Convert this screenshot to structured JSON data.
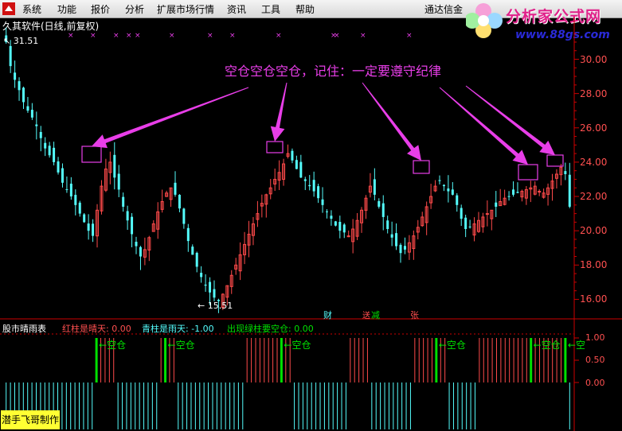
{
  "menu": [
    "系统",
    "功能",
    "报价",
    "分析",
    "扩展市场行情",
    "资讯",
    "工具",
    "帮助"
  ],
  "topright_text": "通达信金",
  "watermark": {
    "title": "分析家公式网",
    "url": "www.88gs.com"
  },
  "chart_title": "久其软件(日线,前复权)",
  "annotation": "空仓空仓空仓，记住：一定要遵守纪律",
  "high_label": "31.51",
  "low_label": "15.51",
  "price_axis_labels": [
    "30.00",
    "28.00",
    "26.00",
    "24.00",
    "22.00",
    "20.00",
    "18.00",
    "16.00"
  ],
  "event_markers": [
    "财",
    "送",
    "减",
    "张"
  ],
  "indicator": {
    "name": "股市晴雨表",
    "red_label": "红柱是晴天: 0.00",
    "cyan_label": "青柱是雨天: -1.00",
    "green_label": "出现绿柱要空仓: 0.00",
    "axis_labels": [
      "1.00",
      "0.50",
      "0.00"
    ],
    "signal_label": "空仓",
    "last_signal_label": "空"
  },
  "footer": "潜手飞哥制作",
  "colors": {
    "up": "#ff4a4a",
    "down": "#54fcfc",
    "green": "#00e000",
    "magenta": "#e83ee8",
    "axis": "#cc0000",
    "red_text": "#ff5050",
    "green_text": "#00e000",
    "cyan_text": "#54fcfc"
  },
  "chart_data": {
    "type": "candlestick",
    "title": "久其软件(日线,前复权)",
    "ylim": [
      15.0,
      31.6
    ],
    "y_ticks": [
      16,
      18,
      20,
      22,
      24,
      26,
      28,
      30
    ],
    "highest": 31.51,
    "lowest": 15.51,
    "close_approx": [
      31.0,
      29.6,
      28.8,
      28.2,
      27.5,
      27.0,
      26.6,
      26.1,
      25.4,
      24.8,
      24.4,
      24.0,
      23.4,
      22.8,
      22.4,
      22.0,
      21.5,
      21.0,
      20.5,
      20.0,
      19.7,
      21.2,
      22.6,
      23.6,
      24.0,
      23.1,
      22.4,
      21.4,
      20.6,
      19.8,
      19.1,
      18.5,
      18.9,
      19.6,
      20.4,
      21.1,
      21.7,
      22.2,
      22.5,
      22.1,
      21.3,
      20.4,
      19.4,
      18.6,
      17.9,
      17.3,
      16.8,
      16.4,
      16.1,
      15.9,
      16.3,
      16.8,
      17.4,
      18.0,
      18.6,
      19.2,
      19.8,
      20.4,
      21.0,
      21.6,
      22.1,
      22.5,
      23.0,
      23.4,
      23.9,
      24.5,
      24.1,
      23.6,
      23.1,
      22.9,
      22.6,
      22.3,
      21.9,
      21.5,
      21.1,
      20.7,
      20.3,
      20.0,
      19.9,
      19.7,
      20.1,
      20.6,
      21.2,
      21.9,
      22.6,
      22.1,
      21.4,
      20.8,
      20.1,
      19.6,
      19.1,
      18.7,
      18.9,
      19.3,
      19.7,
      20.2,
      20.8,
      21.4,
      22.0,
      22.6,
      22.9,
      22.6,
      22.3,
      22.1,
      21.5,
      20.7,
      20.1,
      20.2,
      20.4,
      20.6,
      20.8,
      21.0,
      21.2,
      21.4,
      21.7,
      21.9,
      22.0,
      22.1,
      22.2,
      22.3,
      22.4,
      22.5,
      22.6,
      22.3,
      22.2,
      22.5,
      22.9,
      23.3,
      23.7,
      23.3,
      21.4
    ],
    "indicator_series": {
      "name": "股市晴雨表",
      "ylim": [
        -1.0,
        1.0
      ],
      "y_ticks": [
        0.0,
        0.5,
        1.0
      ],
      "values": [
        -1,
        -1,
        -1,
        -1,
        -1,
        -1,
        -1,
        -1,
        -1,
        -1,
        -1,
        -1,
        -1,
        -1,
        -1,
        -1,
        -1,
        -1,
        -1,
        -1,
        -1,
        0,
        1,
        1,
        1,
        1,
        -1,
        -1,
        -1,
        -1,
        -1,
        -1,
        -1,
        -1,
        -1,
        -1,
        1,
        0,
        1,
        1,
        -1,
        -1,
        -1,
        -1,
        -1,
        -1,
        -1,
        -1,
        -1,
        -1,
        -1,
        -1,
        -1,
        -1,
        -1,
        -1,
        1,
        1,
        1,
        1,
        1,
        1,
        1,
        1,
        0,
        1,
        1,
        -1,
        -1,
        -1,
        -1,
        -1,
        -1,
        -1,
        -1,
        -1,
        -1,
        -1,
        -1,
        -1,
        1,
        1,
        1,
        1,
        1,
        -1,
        -1,
        -1,
        -1,
        -1,
        -1,
        -1,
        -1,
        -1,
        -1,
        1,
        1,
        1,
        1,
        1,
        0,
        1,
        1,
        -1,
        -1,
        -1,
        -1,
        -1,
        -1,
        -1,
        1,
        1,
        1,
        1,
        1,
        1,
        1,
        1,
        1,
        1,
        1,
        1,
        0,
        1,
        1,
        1,
        1,
        1,
        1,
        1,
        0,
        -1
      ]
    }
  }
}
